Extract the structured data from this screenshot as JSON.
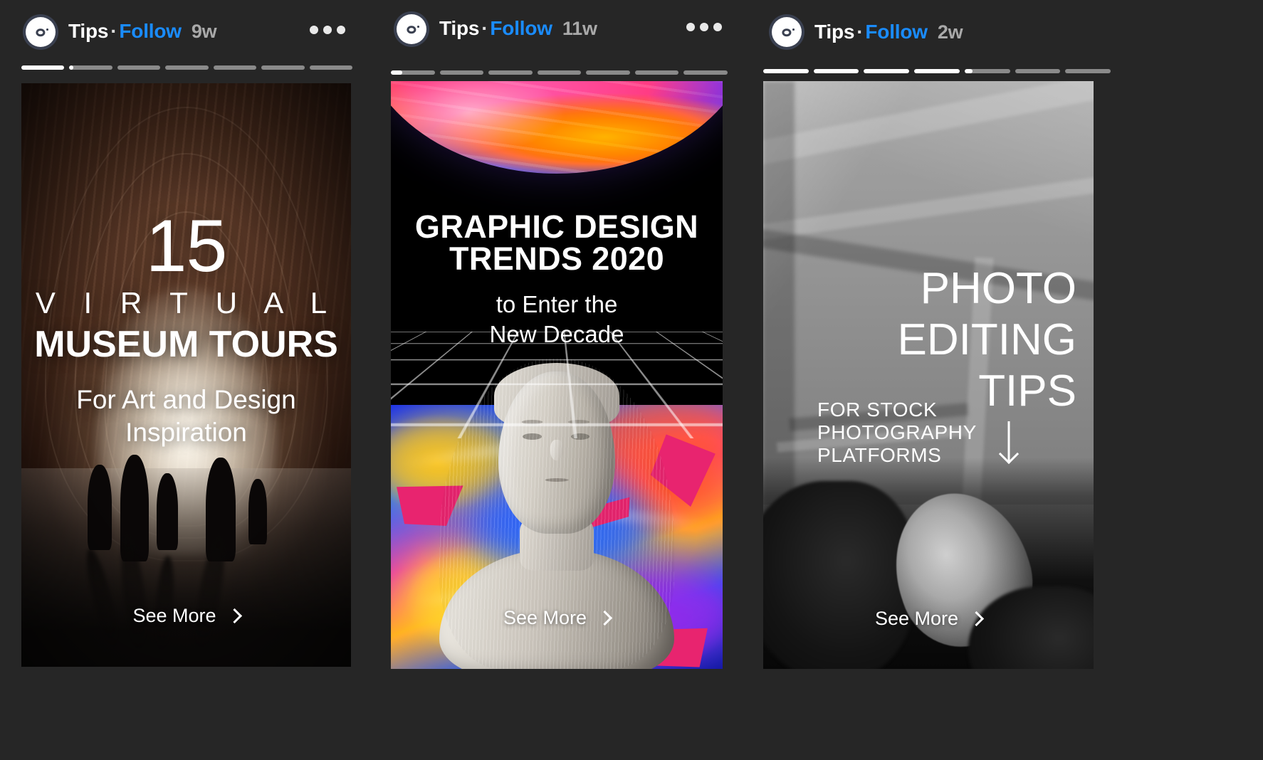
{
  "app": {
    "background_color": "#262626",
    "accent_color": "#1a8cff"
  },
  "panels": [
    {
      "id": "panel-1",
      "account": "Tips",
      "separator": "·",
      "follow_label": "Follow",
      "timestamp": "9w",
      "menu_icon": "more-options-icon",
      "avatar_icon": "camera-icon",
      "progress": {
        "segments": 7,
        "active_index": 1,
        "active_fill_pct": 9,
        "completed": 1
      },
      "story": {
        "headline_number": "15",
        "headline_line1": "V I R T U A L",
        "headline_line2": "MUSEUM TOURS",
        "tagline_line1": "For Art and Design",
        "tagline_line2": "Inspiration",
        "see_more_label": "See More",
        "see_more_icon": "chevron-right-icon"
      }
    },
    {
      "id": "panel-2",
      "account": "Tips",
      "separator": "·",
      "follow_label": "Follow",
      "timestamp": "11w",
      "menu_icon": "more-options-icon",
      "avatar_icon": "camera-icon",
      "progress": {
        "segments": 7,
        "active_index": 0,
        "active_fill_pct": 26,
        "completed": 0
      },
      "story": {
        "title_line1": "GRAPHIC DESIGN",
        "title_line2": "TRENDS 2020",
        "subtitle_line1": "to Enter the",
        "subtitle_line2": "New Decade",
        "see_more_label": "See More",
        "see_more_icon": "chevron-right-icon"
      }
    },
    {
      "id": "panel-3",
      "account": "Tips",
      "separator": "·",
      "follow_label": "Follow",
      "timestamp": "2w",
      "menu_icon": "more-options-icon",
      "avatar_icon": "camera-icon",
      "progress": {
        "segments": 7,
        "active_index": 4,
        "active_fill_pct": 18,
        "completed": 4
      },
      "story": {
        "title_line1": "PHOTO",
        "title_line2": "EDITING",
        "title_line3": "TIPS",
        "subtitle_line1": "FOR STOCK",
        "subtitle_line2": "PHOTOGRAPHY",
        "subtitle_line3": "PLATFORMS",
        "arrow_icon": "arrow-down-icon",
        "see_more_label": "See More",
        "see_more_icon": "chevron-right-icon"
      }
    }
  ]
}
